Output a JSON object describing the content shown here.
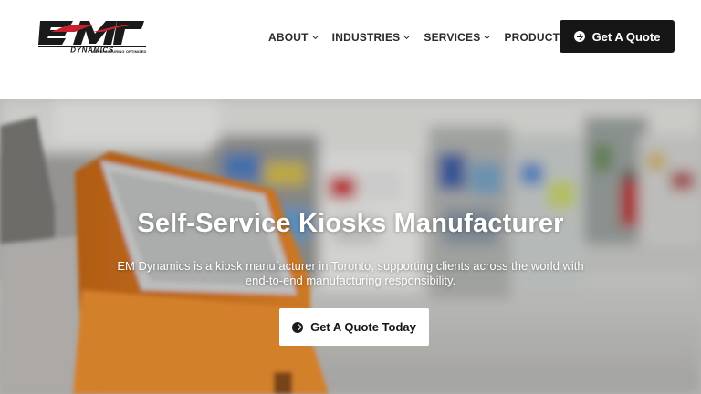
{
  "header": {
    "logo_text": "EM DYNAMICS",
    "logo_tagline": "MANUFACTURING OPTIMIZED",
    "nav": [
      {
        "label": "ABOUT"
      },
      {
        "label": "INDUSTRIES"
      },
      {
        "label": "SERVICES"
      },
      {
        "label": "PRODUCTS"
      }
    ],
    "quote_label": "Get A Quote"
  },
  "hero": {
    "title": "Self-Service Kiosks Manufacturer",
    "subtitle_line1": "EM Dynamics is a kiosk manufacturer in Toronto, supporting clients across the world with",
    "subtitle_line2": "end-to-end manufacturing responsibility.",
    "cta_label": "Get A Quote Today",
    "cta_icon": "arrow-right-circle-icon"
  },
  "colors": {
    "dark_button": "#161616",
    "kiosk_orange": "#e8862a",
    "text_dark": "#2a2a2a"
  }
}
